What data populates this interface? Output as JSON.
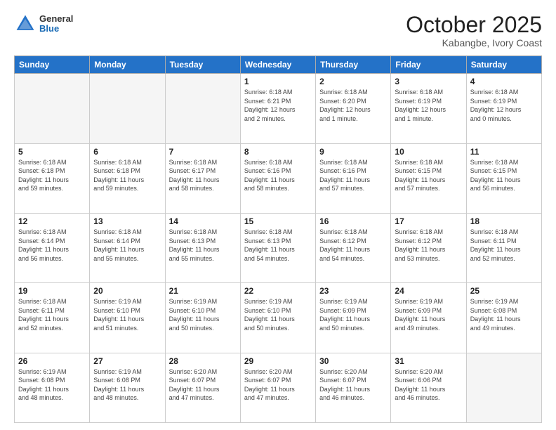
{
  "header": {
    "logo_general": "General",
    "logo_blue": "Blue",
    "title": "October 2025",
    "location": "Kabangbe, Ivory Coast"
  },
  "weekdays": [
    "Sunday",
    "Monday",
    "Tuesday",
    "Wednesday",
    "Thursday",
    "Friday",
    "Saturday"
  ],
  "weeks": [
    [
      {
        "day": "",
        "info": "",
        "empty": true
      },
      {
        "day": "",
        "info": "",
        "empty": true
      },
      {
        "day": "",
        "info": "",
        "empty": true
      },
      {
        "day": "1",
        "info": "Sunrise: 6:18 AM\nSunset: 6:21 PM\nDaylight: 12 hours\nand 2 minutes."
      },
      {
        "day": "2",
        "info": "Sunrise: 6:18 AM\nSunset: 6:20 PM\nDaylight: 12 hours\nand 1 minute."
      },
      {
        "day": "3",
        "info": "Sunrise: 6:18 AM\nSunset: 6:19 PM\nDaylight: 12 hours\nand 1 minute."
      },
      {
        "day": "4",
        "info": "Sunrise: 6:18 AM\nSunset: 6:19 PM\nDaylight: 12 hours\nand 0 minutes."
      }
    ],
    [
      {
        "day": "5",
        "info": "Sunrise: 6:18 AM\nSunset: 6:18 PM\nDaylight: 11 hours\nand 59 minutes."
      },
      {
        "day": "6",
        "info": "Sunrise: 6:18 AM\nSunset: 6:18 PM\nDaylight: 11 hours\nand 59 minutes."
      },
      {
        "day": "7",
        "info": "Sunrise: 6:18 AM\nSunset: 6:17 PM\nDaylight: 11 hours\nand 58 minutes."
      },
      {
        "day": "8",
        "info": "Sunrise: 6:18 AM\nSunset: 6:16 PM\nDaylight: 11 hours\nand 58 minutes."
      },
      {
        "day": "9",
        "info": "Sunrise: 6:18 AM\nSunset: 6:16 PM\nDaylight: 11 hours\nand 57 minutes."
      },
      {
        "day": "10",
        "info": "Sunrise: 6:18 AM\nSunset: 6:15 PM\nDaylight: 11 hours\nand 57 minutes."
      },
      {
        "day": "11",
        "info": "Sunrise: 6:18 AM\nSunset: 6:15 PM\nDaylight: 11 hours\nand 56 minutes."
      }
    ],
    [
      {
        "day": "12",
        "info": "Sunrise: 6:18 AM\nSunset: 6:14 PM\nDaylight: 11 hours\nand 56 minutes."
      },
      {
        "day": "13",
        "info": "Sunrise: 6:18 AM\nSunset: 6:14 PM\nDaylight: 11 hours\nand 55 minutes."
      },
      {
        "day": "14",
        "info": "Sunrise: 6:18 AM\nSunset: 6:13 PM\nDaylight: 11 hours\nand 55 minutes."
      },
      {
        "day": "15",
        "info": "Sunrise: 6:18 AM\nSunset: 6:13 PM\nDaylight: 11 hours\nand 54 minutes."
      },
      {
        "day": "16",
        "info": "Sunrise: 6:18 AM\nSunset: 6:12 PM\nDaylight: 11 hours\nand 54 minutes."
      },
      {
        "day": "17",
        "info": "Sunrise: 6:18 AM\nSunset: 6:12 PM\nDaylight: 11 hours\nand 53 minutes."
      },
      {
        "day": "18",
        "info": "Sunrise: 6:18 AM\nSunset: 6:11 PM\nDaylight: 11 hours\nand 52 minutes."
      }
    ],
    [
      {
        "day": "19",
        "info": "Sunrise: 6:18 AM\nSunset: 6:11 PM\nDaylight: 11 hours\nand 52 minutes."
      },
      {
        "day": "20",
        "info": "Sunrise: 6:19 AM\nSunset: 6:10 PM\nDaylight: 11 hours\nand 51 minutes."
      },
      {
        "day": "21",
        "info": "Sunrise: 6:19 AM\nSunset: 6:10 PM\nDaylight: 11 hours\nand 50 minutes."
      },
      {
        "day": "22",
        "info": "Sunrise: 6:19 AM\nSunset: 6:10 PM\nDaylight: 11 hours\nand 50 minutes."
      },
      {
        "day": "23",
        "info": "Sunrise: 6:19 AM\nSunset: 6:09 PM\nDaylight: 11 hours\nand 50 minutes."
      },
      {
        "day": "24",
        "info": "Sunrise: 6:19 AM\nSunset: 6:09 PM\nDaylight: 11 hours\nand 49 minutes."
      },
      {
        "day": "25",
        "info": "Sunrise: 6:19 AM\nSunset: 6:08 PM\nDaylight: 11 hours\nand 49 minutes."
      }
    ],
    [
      {
        "day": "26",
        "info": "Sunrise: 6:19 AM\nSunset: 6:08 PM\nDaylight: 11 hours\nand 48 minutes."
      },
      {
        "day": "27",
        "info": "Sunrise: 6:19 AM\nSunset: 6:08 PM\nDaylight: 11 hours\nand 48 minutes."
      },
      {
        "day": "28",
        "info": "Sunrise: 6:20 AM\nSunset: 6:07 PM\nDaylight: 11 hours\nand 47 minutes."
      },
      {
        "day": "29",
        "info": "Sunrise: 6:20 AM\nSunset: 6:07 PM\nDaylight: 11 hours\nand 47 minutes."
      },
      {
        "day": "30",
        "info": "Sunrise: 6:20 AM\nSunset: 6:07 PM\nDaylight: 11 hours\nand 46 minutes."
      },
      {
        "day": "31",
        "info": "Sunrise: 6:20 AM\nSunset: 6:06 PM\nDaylight: 11 hours\nand 46 minutes."
      },
      {
        "day": "",
        "info": "",
        "empty": true
      }
    ]
  ]
}
